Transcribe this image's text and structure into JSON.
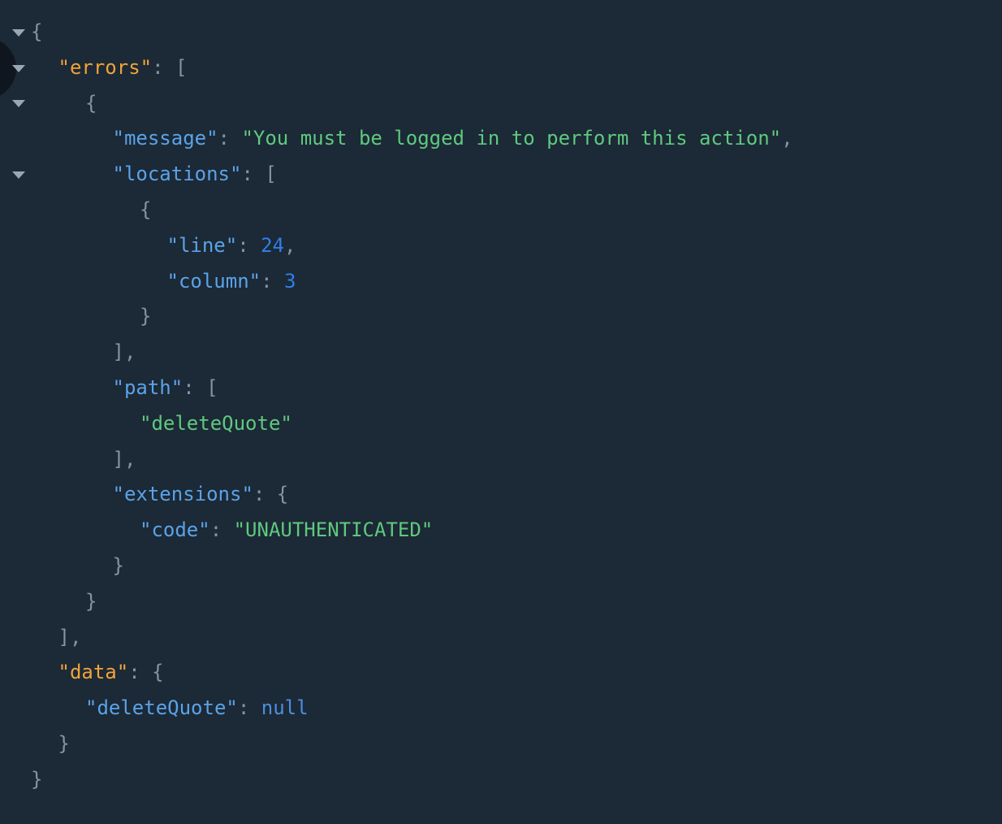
{
  "viewer": {
    "name": "graphql-response-viewer",
    "background_color": "#1c2936",
    "colors": {
      "root_key": "#f0a33a",
      "key": "#5aa3e8",
      "string": "#5fc97f",
      "number": "#2f7fe8",
      "null": "#4a8fe0",
      "punctuation": "#8494a2",
      "fold_arrow": "#9aa7b2",
      "orb": "#10161f"
    },
    "fold_arrows": [
      {
        "name": "fold-toggle-root",
        "line": 0,
        "state": "expanded"
      },
      {
        "name": "fold-toggle-errors",
        "line": 1,
        "state": "expanded"
      },
      {
        "name": "fold-toggle-error-item",
        "line": 2,
        "state": "expanded"
      },
      {
        "name": "fold-toggle-locations",
        "line": 4,
        "state": "expanded"
      }
    ]
  },
  "response": {
    "errors": [
      {
        "message": "You must be logged in to perform this action",
        "locations": [
          {
            "line": 24,
            "column": 3
          }
        ],
        "path": [
          "deleteQuote"
        ],
        "extensions": {
          "code": "UNAUTHENTICATED"
        }
      }
    ],
    "data": {
      "deleteQuote": null
    }
  },
  "lines": [
    {
      "indent": 0,
      "tokens": [
        {
          "t": "brace",
          "v": "{"
        }
      ]
    },
    {
      "indent": 1,
      "tokens": [
        {
          "t": "key-root",
          "v": "\"errors\""
        },
        {
          "t": "punct",
          "v": ": "
        },
        {
          "t": "brace",
          "v": "["
        }
      ]
    },
    {
      "indent": 2,
      "tokens": [
        {
          "t": "brace",
          "v": "{"
        }
      ]
    },
    {
      "indent": 3,
      "tokens": [
        {
          "t": "key",
          "v": "\"message\""
        },
        {
          "t": "punct",
          "v": ": "
        },
        {
          "t": "string",
          "v": "\"You must be logged in to perform this action\""
        },
        {
          "t": "punct",
          "v": ","
        }
      ]
    },
    {
      "indent": 3,
      "tokens": [
        {
          "t": "key",
          "v": "\"locations\""
        },
        {
          "t": "punct",
          "v": ": "
        },
        {
          "t": "brace",
          "v": "["
        }
      ]
    },
    {
      "indent": 4,
      "tokens": [
        {
          "t": "brace",
          "v": "{"
        }
      ]
    },
    {
      "indent": 5,
      "tokens": [
        {
          "t": "key",
          "v": "\"line\""
        },
        {
          "t": "punct",
          "v": ": "
        },
        {
          "t": "number",
          "v": "24"
        },
        {
          "t": "punct",
          "v": ","
        }
      ]
    },
    {
      "indent": 5,
      "tokens": [
        {
          "t": "key",
          "v": "\"column\""
        },
        {
          "t": "punct",
          "v": ": "
        },
        {
          "t": "number",
          "v": "3"
        }
      ]
    },
    {
      "indent": 4,
      "tokens": [
        {
          "t": "brace",
          "v": "}"
        }
      ]
    },
    {
      "indent": 3,
      "tokens": [
        {
          "t": "brace",
          "v": "]"
        },
        {
          "t": "punct",
          "v": ","
        }
      ]
    },
    {
      "indent": 3,
      "tokens": [
        {
          "t": "key",
          "v": "\"path\""
        },
        {
          "t": "punct",
          "v": ": "
        },
        {
          "t": "brace",
          "v": "["
        }
      ]
    },
    {
      "indent": 4,
      "tokens": [
        {
          "t": "string",
          "v": "\"deleteQuote\""
        }
      ]
    },
    {
      "indent": 3,
      "tokens": [
        {
          "t": "brace",
          "v": "]"
        },
        {
          "t": "punct",
          "v": ","
        }
      ]
    },
    {
      "indent": 3,
      "tokens": [
        {
          "t": "key",
          "v": "\"extensions\""
        },
        {
          "t": "punct",
          "v": ": "
        },
        {
          "t": "brace",
          "v": "{"
        }
      ]
    },
    {
      "indent": 4,
      "tokens": [
        {
          "t": "key",
          "v": "\"code\""
        },
        {
          "t": "punct",
          "v": ": "
        },
        {
          "t": "string",
          "v": "\"UNAUTHENTICATED\""
        }
      ]
    },
    {
      "indent": 3,
      "tokens": [
        {
          "t": "brace",
          "v": "}"
        }
      ]
    },
    {
      "indent": 2,
      "tokens": [
        {
          "t": "brace",
          "v": "}"
        }
      ]
    },
    {
      "indent": 1,
      "tokens": [
        {
          "t": "brace",
          "v": "]"
        },
        {
          "t": "punct",
          "v": ","
        }
      ]
    },
    {
      "indent": 1,
      "tokens": [
        {
          "t": "key-root",
          "v": "\"data\""
        },
        {
          "t": "punct",
          "v": ": "
        },
        {
          "t": "brace",
          "v": "{"
        }
      ]
    },
    {
      "indent": 2,
      "tokens": [
        {
          "t": "key",
          "v": "\"deleteQuote\""
        },
        {
          "t": "punct",
          "v": ": "
        },
        {
          "t": "null",
          "v": "null"
        }
      ]
    },
    {
      "indent": 1,
      "tokens": [
        {
          "t": "brace",
          "v": "}"
        }
      ]
    },
    {
      "indent": 0,
      "tokens": [
        {
          "t": "brace",
          "v": "}"
        }
      ]
    }
  ]
}
